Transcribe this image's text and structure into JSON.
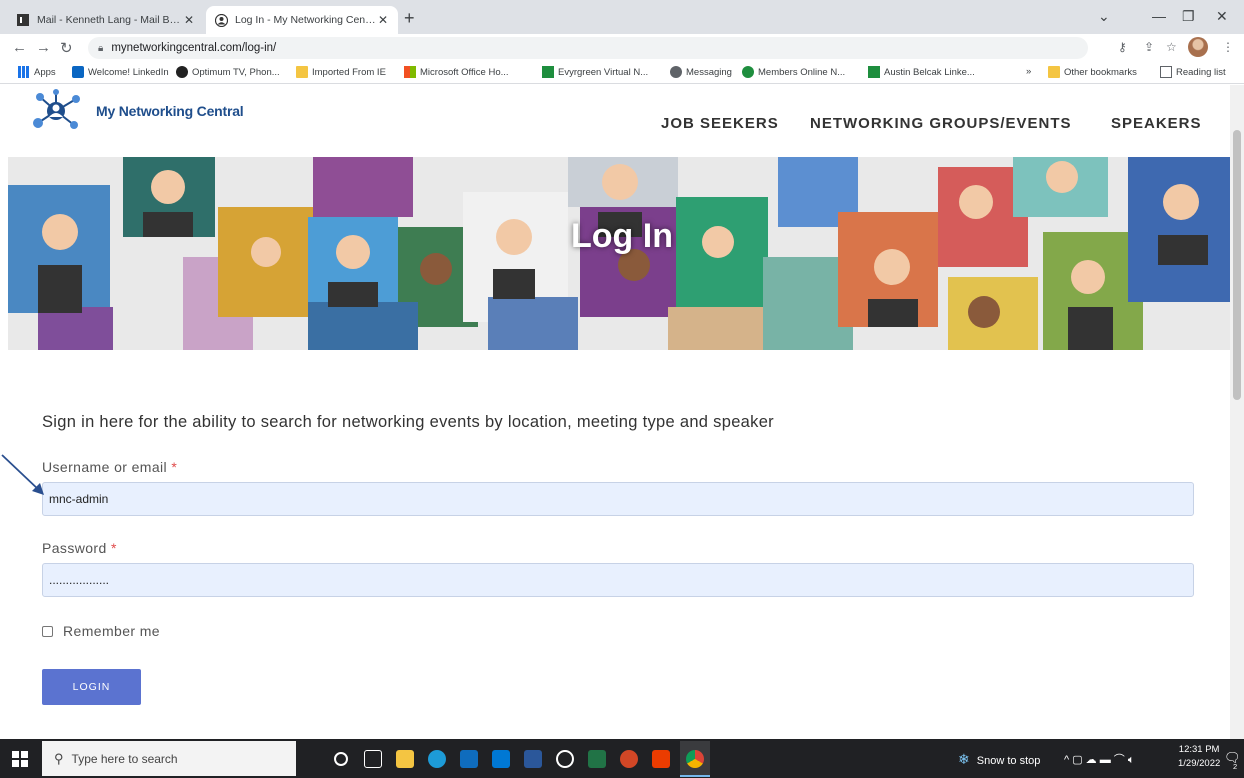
{
  "browser": {
    "tabs": [
      {
        "title": "Mail - Kenneth Lang - Mail Busin",
        "active": false
      },
      {
        "title": "Log In - My Networking Central",
        "active": true
      }
    ],
    "url": "mynetworkingcentral.com/log-in/",
    "bookmarks": [
      "Apps",
      "Welcome! LinkedIn",
      "Optimum TV, Phon...",
      "Imported From IE",
      "Microsoft Office Ho...",
      "Evyrgreen Virtual N...",
      "Messaging",
      "Members Online N...",
      "Austin Belcak Linke..."
    ],
    "overflow": "»",
    "other_bookmarks": "Other bookmarks",
    "reading_list": "Reading list"
  },
  "site": {
    "logo_text": "My Networking Central",
    "nav": [
      "JOB SEEKERS",
      "NETWORKING GROUPS/EVENTS",
      "SPEAKERS"
    ],
    "hero_title": "Log In"
  },
  "login": {
    "intro": "Sign in here for the ability to search for networking events by location, meeting type and speaker",
    "username_label": "Username or email",
    "username_value": "mnc-admin",
    "password_label": "Password",
    "password_value": "..................",
    "required_mark": "*",
    "remember_label": "Remember me",
    "login_button": "LOGIN"
  },
  "taskbar": {
    "search_placeholder": "Type here to search",
    "weather": "Snow to stop",
    "time": "12:31 PM",
    "date": "1/29/2022",
    "notifications": "2"
  }
}
